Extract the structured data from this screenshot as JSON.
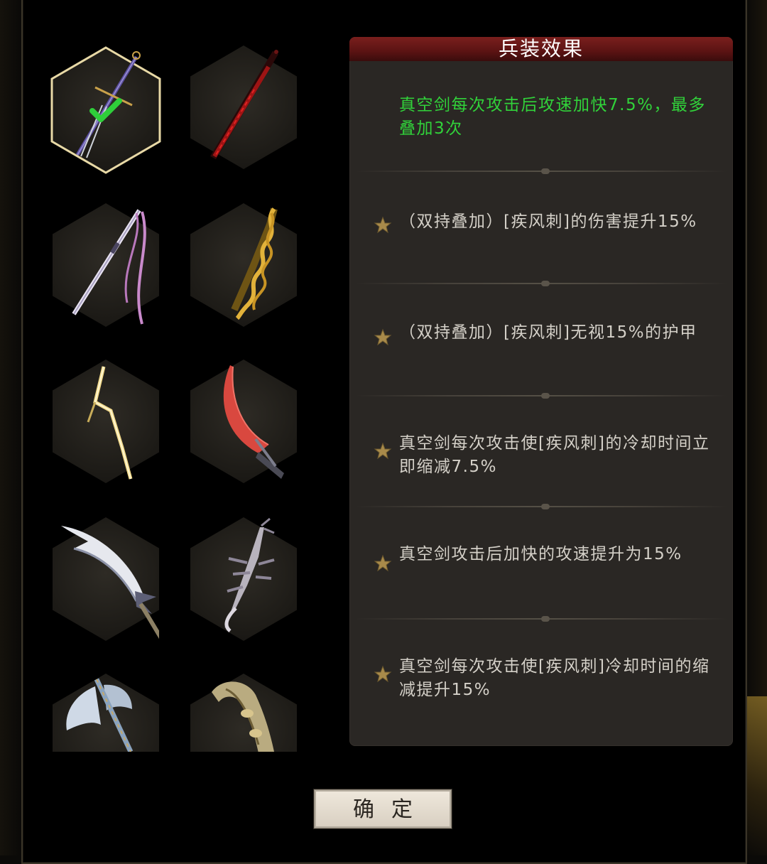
{
  "panel": {
    "title": "兵装效果",
    "active_effect": "真空剑每次攻击后攻速加快7.5%，最多叠加3次",
    "effects": [
      "（双持叠加）[疾风刺]的伤害提升15%",
      "（双持叠加）[疾风刺]无视15%的护甲",
      "真空剑每次攻击使[疾风刺]的冷却时间立即缩减7.5%",
      "真空剑攻击后加快的攻速提升为15%",
      "真空剑每次攻击使[疾风刺]冷却时间的缩减提升15%"
    ]
  },
  "weapons": [
    {
      "name": "dagger-weapon",
      "selected": true
    },
    {
      "name": "red-serrated-blade",
      "selected": false
    },
    {
      "name": "ribbon-katana",
      "selected": false
    },
    {
      "name": "golden-twisted-rod",
      "selected": false
    },
    {
      "name": "lightning-bolt-blade",
      "selected": false
    },
    {
      "name": "crimson-curved-blade",
      "selected": false
    },
    {
      "name": "silver-scimitar",
      "selected": false
    },
    {
      "name": "spiked-bone-sword",
      "selected": false
    },
    {
      "name": "battle-axe",
      "selected": false
    },
    {
      "name": "carved-horn-club",
      "selected": false
    }
  ],
  "confirm_button": {
    "label": "确定"
  },
  "colors": {
    "active_effect": "#31d23a",
    "header_red": "#6b1818",
    "panel_bg": "#2a2724",
    "selected_outline": "#e8d9a6"
  }
}
